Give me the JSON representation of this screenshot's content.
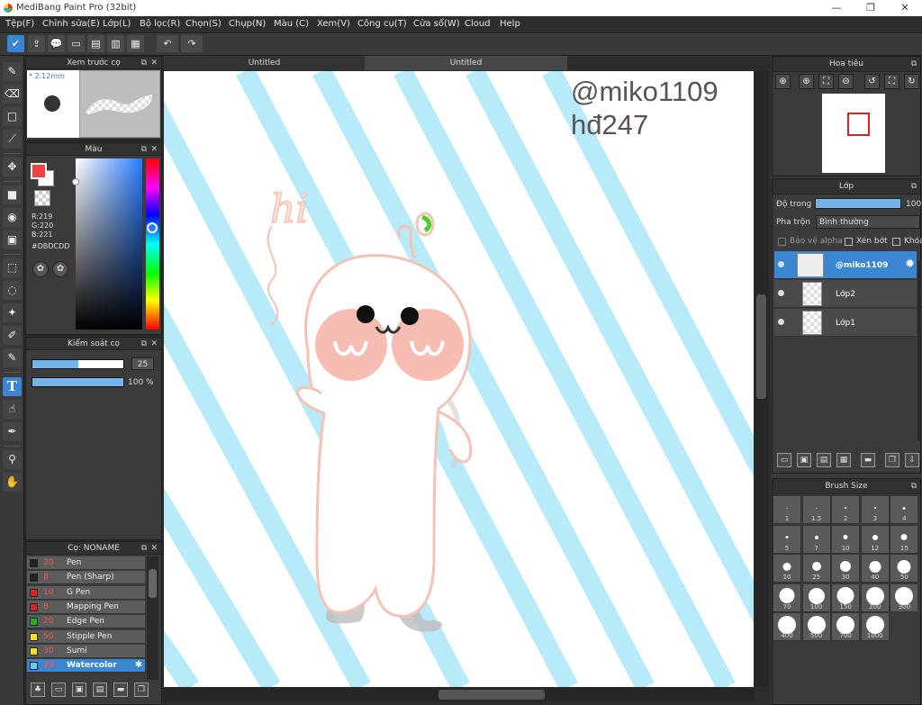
{
  "window": {
    "title": "MediBang Paint Pro (32bit)",
    "minimize": "—",
    "maximize": "❐",
    "close": "✕"
  },
  "menu": [
    "Tệp(F)",
    "Chỉnh sửa(E)",
    "Lớp(L)",
    "Bộ lọc(R)",
    "Chọn(S)",
    "Chụp(N)",
    "Màu (C)",
    "Xem(V)",
    "Công cụ(T)",
    "Cửa sổ(W)",
    "Cloud",
    "Help"
  ],
  "toolbar": {
    "icons": [
      "cloud-check-icon",
      "export-icon",
      "speech-bubble-icon",
      "comment-icon",
      "page-icon",
      "page-list-icon",
      "page-grid-icon",
      "page-manage-icon",
      "undo-icon",
      "redo-icon"
    ],
    "glyphs": [
      "✔",
      "⇪",
      "💬",
      "▭",
      "▤",
      "▥",
      "▦",
      "▧",
      "↶",
      "↷"
    ]
  },
  "tools": {
    "icons": [
      "brush-tool-icon",
      "eraser-tool-icon",
      "rectangle-tool-icon",
      "pen-line-icon",
      "move-tool-icon",
      "fill-rect-icon",
      "bucket-tool-icon",
      "gradient-tool-icon",
      "rect-select-icon",
      "lasso-select-icon",
      "magic-wand-icon",
      "select-pen-icon",
      "select-eraser-icon",
      "text-tool-icon",
      "operation-tool-icon",
      "dropper-tool-icon",
      "eyedropper-icon",
      "hand-tool-icon"
    ],
    "glyphs": [
      "✎",
      "⌫",
      "□",
      "⟋",
      "✥",
      "■",
      "◉",
      "▣",
      "⬚",
      "◌",
      "✦",
      "✐",
      "✎",
      "T",
      "☝",
      "✒",
      "⚲",
      "✋"
    ]
  },
  "brush_preview": {
    "title": "Xem trước cọ",
    "size": "* 2.12mm"
  },
  "color": {
    "title": "Màu",
    "r": "R:219",
    "g": "G:220",
    "b": "B:221",
    "hex": "#DBDCDD"
  },
  "brush_control": {
    "title": "Kiểm soát cọ",
    "size_value": "25",
    "size_fill": 0.5,
    "opacity_value": "100 %",
    "opacity_fill": 1.0
  },
  "brush_list": {
    "title": "Cọ: NONAME",
    "items": [
      {
        "size": "20",
        "name": "Pen",
        "color": "#222222",
        "selected": false
      },
      {
        "size": "8",
        "name": "Pen (Sharp)",
        "color": "#222222",
        "selected": false
      },
      {
        "size": "10",
        "name": "G Pen",
        "color": "#e02020",
        "selected": false
      },
      {
        "size": "8",
        "name": "Mapping Pen",
        "color": "#e02020",
        "selected": false
      },
      {
        "size": "20",
        "name": "Edge Pen",
        "color": "#20b020",
        "selected": false
      },
      {
        "size": "50",
        "name": "Stipple Pen",
        "color": "#f0e020",
        "selected": false
      },
      {
        "size": "30",
        "name": "Sumi",
        "color": "#f0e020",
        "selected": false
      },
      {
        "size": "20",
        "name": "Watercolor",
        "color": "#70c8f0",
        "selected": true
      }
    ],
    "buttons": [
      "add-brush-icon",
      "new-page-icon",
      "brush-menu-icon",
      "copy-brush-icon",
      "folder-icon",
      "duplicate-icon"
    ],
    "glyphs": [
      "♣",
      "▭",
      "▣",
      "▤",
      "▬",
      "❐"
    ]
  },
  "canvas": {
    "tabs": [
      "Untitled",
      "Untitled"
    ],
    "watermark_line1": "@miko1109",
    "watermark_line2": "hđ247",
    "hi_text": "hi"
  },
  "navigator": {
    "title": "Hoa tiêu",
    "buttons": [
      "zoom-in-icon",
      "zoom-in-alt-icon",
      "fit-screen-icon",
      "zoom-out-icon",
      "rotate-left-icon",
      "fullscreen-icon",
      "rotate-right-icon"
    ],
    "glyphs": [
      "⊕",
      "⊕",
      "⛶",
      "⊖",
      "↺",
      "⛶",
      "↻"
    ]
  },
  "layers": {
    "title": "Lớp",
    "opacity_label": "Độ trong",
    "opacity_value": "100",
    "blend_label": "Pha trộn",
    "blend_value": "Bình thường",
    "protect_alpha": "Bảo vệ alpha",
    "clipping": "Xén bớt",
    "lock": "Khóa",
    "items": [
      {
        "name": "@miko1109",
        "selected": true
      },
      {
        "name": "Lớp2",
        "selected": false
      },
      {
        "name": "Lớp1",
        "selected": false
      }
    ],
    "buttons": [
      "new-layer-icon",
      "new-halftone-layer-icon",
      "new-1bit-layer-icon",
      "layer-menu-icon",
      "layer-folder-icon",
      "duplicate-layer-icon",
      "merge-layer-icon"
    ],
    "glyphs": [
      "▭",
      "▣",
      "▤",
      "▦",
      "▬",
      "❐",
      "⇩"
    ]
  },
  "brush_size": {
    "title": "Brush Size",
    "sizes": [
      "1",
      "1.5",
      "2",
      "3",
      "4",
      "5",
      "7",
      "10",
      "12",
      "15",
      "20",
      "25",
      "30",
      "40",
      "50",
      "70",
      "100",
      "150",
      "200",
      "300",
      "400",
      "500",
      "700",
      "1000"
    ],
    "dots": [
      1,
      1,
      2,
      2,
      3,
      3,
      4,
      5,
      6,
      7,
      9,
      10,
      12,
      13,
      15,
      17,
      18,
      19,
      20,
      20,
      20,
      20,
      20,
      20
    ]
  }
}
